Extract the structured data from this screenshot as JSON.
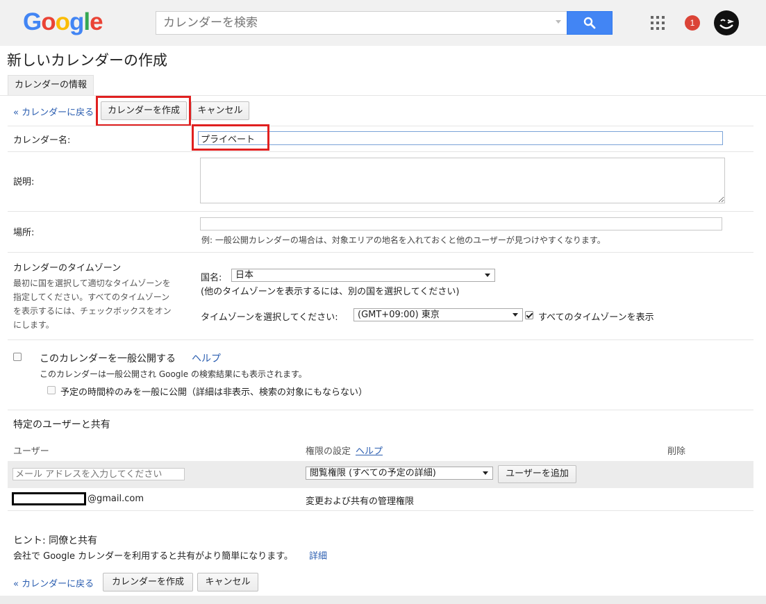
{
  "header": {
    "logo": [
      "G",
      "o",
      "o",
      "g",
      "l",
      "e"
    ],
    "logo_colors": [
      "#4285f4",
      "#ea4335",
      "#fbbc05",
      "#4285f4",
      "#34a853",
      "#ea4335"
    ],
    "search_placeholder": "カレンダーを検索",
    "notification_count": "1",
    "icons": {
      "search": "search-icon",
      "apps": "apps-grid-icon",
      "avatar": "avatar-icon"
    }
  },
  "page": {
    "title": "新しいカレンダーの作成",
    "tab": "カレンダーの情報"
  },
  "toolbar": {
    "back_link": "« カレンダーに戻る",
    "create_button": "カレンダーを作成",
    "cancel_button": "キャンセル"
  },
  "form": {
    "name_label": "カレンダー名:",
    "name_value": "プライベート",
    "description_label": "説明:",
    "description_value": "",
    "location_label": "場所:",
    "location_value": "",
    "location_hint": "例: 一般公開カレンダーの場合は、対象エリアの地名を入れておくと他のユーザーが見つけやすくなります。",
    "timezone": {
      "heading": "カレンダーのタイムゾーン",
      "description_lines": [
        "最初に国を選択して適切なタイムゾーンを",
        "指定してください。すべてのタイムゾーン",
        "を表示するには、チェックボックスをオン",
        "にします。"
      ],
      "country_label": "国名:",
      "country_value": "日本",
      "country_hint": "(他のタイムゾーンを表示するには、別の国を選択してください)",
      "tz_label": "タイムゾーンを選択してください:",
      "tz_value": "(GMT+09:00) 東京",
      "show_all_label": "すべてのタイムゾーンを表示",
      "show_all_checked": true
    },
    "public": {
      "label": "このカレンダーを一般公開する",
      "help_link": "ヘルプ",
      "checked": false,
      "note": "このカレンダーは一般公開され Google の検索結果にも表示されます。",
      "free_busy_label": "予定の時間枠のみを一般に公開（詳細は非表示、検索の対象にもならない）",
      "free_busy_checked": false
    }
  },
  "sharing": {
    "heading": "特定のユーザーと共有",
    "col_user": "ユーザー",
    "col_permission": "権限の設定",
    "col_permission_help": "ヘルプ",
    "col_delete": "削除",
    "email_placeholder": "メール アドレスを入力してください",
    "permission_select": "閲覧権限 (すべての予定の詳細)",
    "add_user_button": "ユーザーを追加",
    "owner_email_suffix": "@gmail.com",
    "owner_permission": "変更および共有の管理権限"
  },
  "hint": {
    "title": "ヒント: 同僚と共有",
    "text": "会社で Google カレンダーを利用すると共有がより簡単になります。",
    "link": "詳細"
  }
}
